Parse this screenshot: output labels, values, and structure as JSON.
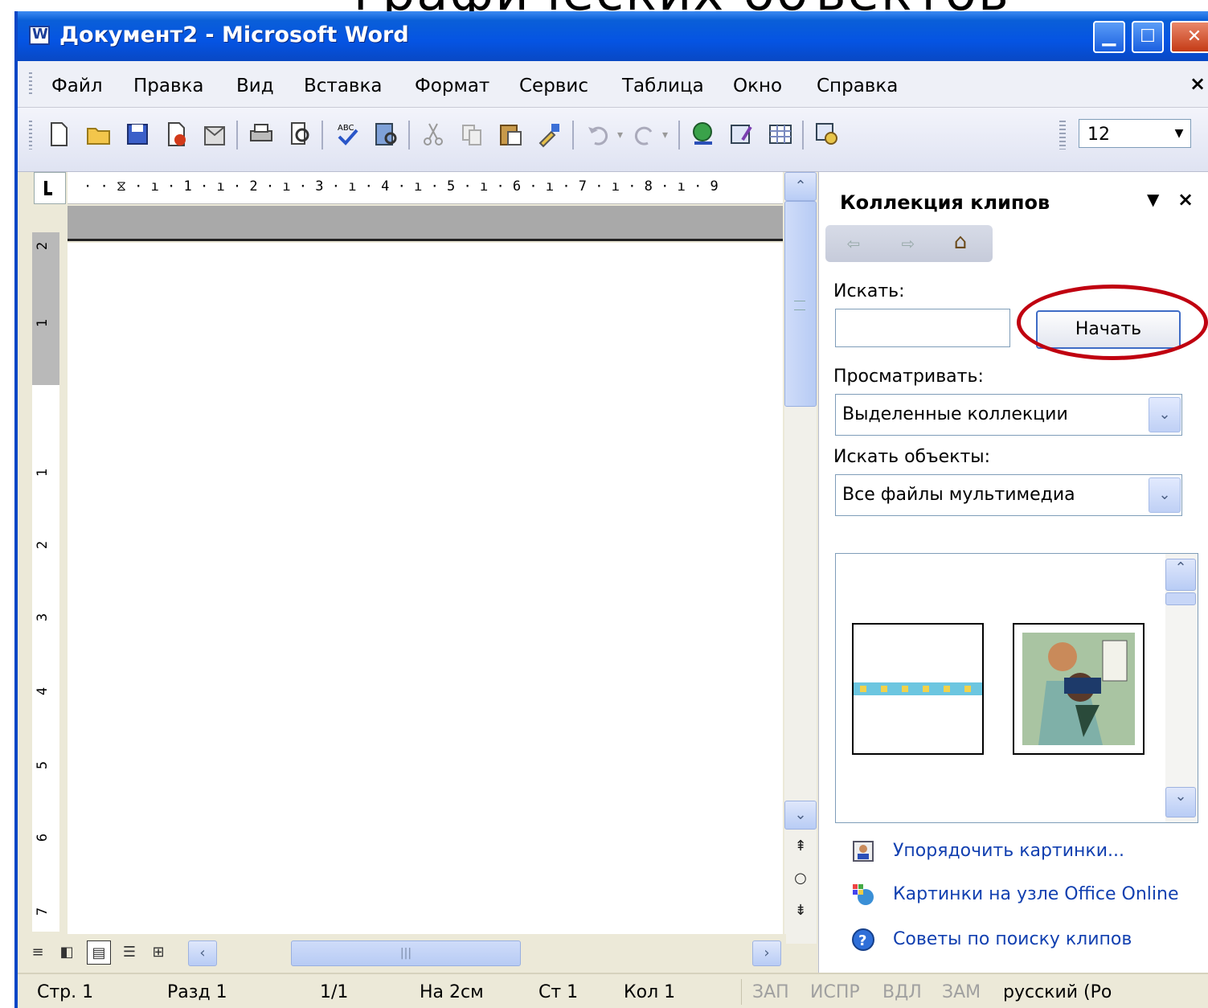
{
  "slide_heading_fragment": "графических объектов",
  "window": {
    "title": "Документ2 - Microsoft Word"
  },
  "menu": {
    "items": [
      "Файл",
      "Правка",
      "Вид",
      "Вставка",
      "Формат",
      "Сервис",
      "Таблица",
      "Окно",
      "Справка"
    ],
    "close": "×"
  },
  "toolbar": {
    "font_size": "12",
    "icons": [
      "new-document-icon",
      "open-icon",
      "save-icon",
      "permission-icon",
      "email-icon",
      "print-icon",
      "print-preview-icon",
      "spelling-icon",
      "research-icon",
      "cut-icon",
      "copy-icon",
      "paste-icon",
      "format-painter-icon",
      "undo-icon",
      "redo-icon",
      "hyperlink-icon",
      "tables-borders-icon",
      "insert-table-icon",
      "drawing-icon"
    ]
  },
  "ruler": {
    "horizontal": "· · ⧖ · ı · 1 · ı · 2 · ı · 3 · ı · 4 · ı · 5 · ı · 6 · ı · 7 · ı · 8 · ı · 9",
    "vertical_numbers": [
      "2",
      "1",
      "1",
      "2",
      "3",
      "4",
      "5",
      "6",
      "7"
    ]
  },
  "task_pane": {
    "title": "Коллекция клипов",
    "search_label": "Искать:",
    "search_value": "",
    "start_button": "Начать",
    "browse_label": "Просматривать:",
    "browse_value": "Выделенные коллекции",
    "object_label": "Искать объекты:",
    "object_value": "Все файлы мультимедиа",
    "links": [
      "Упорядочить картинки...",
      "Картинки на узле Office Online",
      "Советы по поиску клипов"
    ]
  },
  "status": {
    "page": "Стр. 1",
    "section": "Разд 1",
    "pages": "1/1",
    "at": "На 2см",
    "line": "Ст 1",
    "col": "Кол 1",
    "rec": "ЗАП",
    "trk": "ИСПР",
    "ext": "ВДЛ",
    "ovr": "ЗАМ",
    "language": "русский (Ро"
  },
  "colors": {
    "titlebar": "#0554e3",
    "highlight_circle": "#c00010",
    "link": "#1240b0"
  }
}
